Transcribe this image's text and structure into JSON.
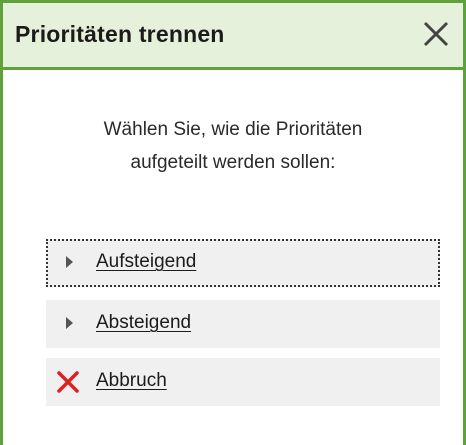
{
  "dialog": {
    "title": "Prioritäten trennen",
    "close_icon": "close-icon",
    "message_line1": "Wählen Sie, wie die Prioritäten",
    "message_line2": "aufgeteilt werden sollen:"
  },
  "options": [
    {
      "label": "Aufsteigend",
      "icon": "triangle-right-icon",
      "focused": true
    },
    {
      "label": "Absteigend",
      "icon": "triangle-right-icon",
      "focused": false
    },
    {
      "label": "Abbruch",
      "icon": "red-x-icon",
      "focused": false
    }
  ],
  "colors": {
    "accent_green": "#5fa23c",
    "titlebar_bg": "#e6f1dc",
    "option_bg": "#f0f0f0",
    "cancel_red": "#e02020"
  }
}
